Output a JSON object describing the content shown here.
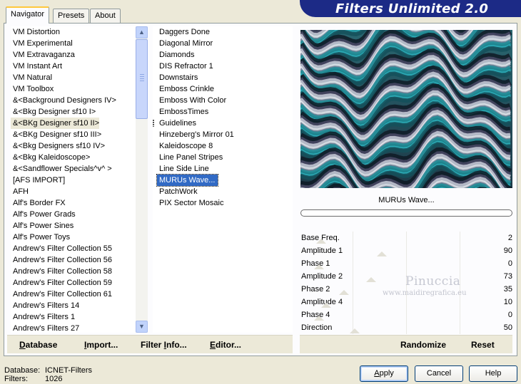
{
  "app": {
    "title": "Filters Unlimited 2.0",
    "brand_color": "#1c2a86"
  },
  "tabs": [
    {
      "label": "Navigator",
      "active": true
    },
    {
      "label": "Presets",
      "active": false
    },
    {
      "label": "About",
      "active": false
    }
  ],
  "categories": {
    "items": [
      "VM Distortion",
      "VM Experimental",
      "VM Extravaganza",
      "VM Instant Art",
      "VM Natural",
      "VM Toolbox",
      "&<Background Designers IV>",
      "&<Bkg Designer sf10 I>",
      "&<BKg Designer sf10 II>",
      "&<BKg Designer sf10 III>",
      "&<Bkg Designers sf10 IV>",
      "&<Bkg Kaleidoscope>",
      "&<Sandflower Specials^v^ >",
      "[AFS IMPORT]",
      "AFH",
      "Alf's Border FX",
      "Alf's Power Grads",
      "Alf's Power Sines",
      "Alf's Power Toys",
      "Andrew's Filter Collection 55",
      "Andrew's Filter Collection 56",
      "Andrew's Filter Collection 58",
      "Andrew's Filter Collection 59",
      "Andrew's Filter Collection 61",
      "Andrew's Filters 14",
      "Andrew's Filters 1",
      "Andrew's Filters 27"
    ],
    "selected_index": 8
  },
  "filters": {
    "items": [
      "Daggers Done",
      "Diagonal Mirror",
      "Diamonds",
      "DIS Refractor 1",
      "Downstairs",
      "Emboss Crinkle",
      "Emboss With Color",
      "EmbossTimes",
      "Guidelines",
      "Hinzeberg's Mirror 01",
      "Kaleidoscope 8",
      "Line Panel Stripes",
      "Line Side Line",
      "MURUs Wave...",
      "PatchWork",
      "PIX Sector Mosaic"
    ],
    "selected_index": 13,
    "marked_index": 8
  },
  "bottom_links": {
    "database": {
      "label": "Database",
      "underline": "D",
      "rest": "atabase"
    },
    "import": {
      "label": "Import...",
      "underline": "I",
      "rest": "mport..."
    },
    "filter_info": {
      "label": "Filter Info...",
      "pre": "Filter ",
      "underline": "I",
      "rest": "nfo..."
    },
    "editor": {
      "label": "Editor...",
      "underline": "E",
      "rest": "ditor..."
    }
  },
  "effect": {
    "name": "MURUs Wave...",
    "progress": 0
  },
  "params": [
    {
      "name": "Base Freq.",
      "value": "2",
      "level": 0.01
    },
    {
      "name": "Amplitude 1",
      "value": "90",
      "level": 0.35
    },
    {
      "name": "Phase 1",
      "value": "0",
      "level": 0.0
    },
    {
      "name": "Amplitude 2",
      "value": "73",
      "level": 0.29
    },
    {
      "name": "Phase 2",
      "value": "35",
      "level": 0.14
    },
    {
      "name": "Amplitude 4",
      "value": "10",
      "level": 0.04
    },
    {
      "name": "Phase 4",
      "value": "0",
      "level": 0.0
    },
    {
      "name": "Direction",
      "value": "50",
      "level": 0.2
    }
  ],
  "right_buttons": {
    "randomize": "Randomize",
    "reset": "Reset"
  },
  "watermark": {
    "name": "Pinuccia",
    "site": "www.maidiregrafica.eu"
  },
  "footer": {
    "database_label": "Database:",
    "database_value": "ICNET-Filters",
    "filters_label": "Filters:",
    "filters_value": "1026"
  },
  "dialog_buttons": {
    "apply": {
      "pre": "",
      "underline": "A",
      "rest": "pply"
    },
    "cancel": "Cancel",
    "help": "Help"
  },
  "colors": {
    "selection_blue": "#316ac5",
    "wave_teal": "#1d8f99",
    "wave_dark": "#1b2f3a",
    "wave_light": "#d8dce6"
  }
}
